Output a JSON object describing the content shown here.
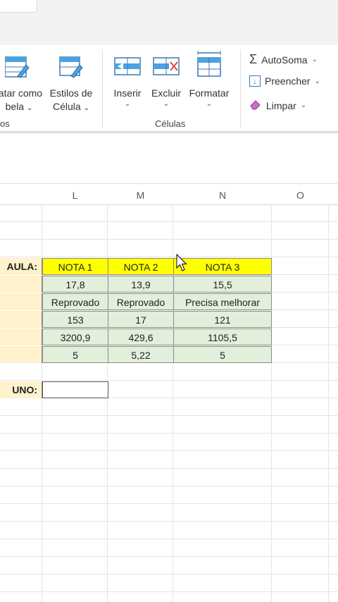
{
  "ribbon": {
    "styles_group": {
      "format_table": {
        "line1": "tatar como",
        "line2": "bela"
      },
      "cell_styles": {
        "line1": "Estilos de",
        "line2": "Célula"
      },
      "group_label": "os"
    },
    "cells_group": {
      "insert": "Inserir",
      "delete": "Excluir",
      "format": "Formatar",
      "group_label": "Células"
    },
    "editing_group": {
      "autosum": "AutoSoma",
      "fill": "Preencher",
      "clear": "Limpar"
    }
  },
  "columns": [
    "L",
    "M",
    "N",
    "O"
  ],
  "table": {
    "row_label_header": "AULA:",
    "headers": [
      "NOTA 1",
      "NOTA 2",
      "NOTA 3"
    ],
    "rows": [
      [
        "17,8",
        "13,9",
        "15,5"
      ],
      [
        "Reprovado",
        "Reprovado",
        "Precisa melhorar"
      ],
      [
        "153",
        "17",
        "121"
      ],
      [
        "3200,9",
        "429,6",
        "1105,5"
      ],
      [
        "5",
        "5,22",
        "5"
      ]
    ],
    "student_label": "UNO:",
    "student_value": ""
  },
  "colors": {
    "header_yellow": "#ffff00",
    "label_cream": "#fff2cc",
    "data_green": "#e2efda",
    "excel_blue": "#4aa3df"
  }
}
